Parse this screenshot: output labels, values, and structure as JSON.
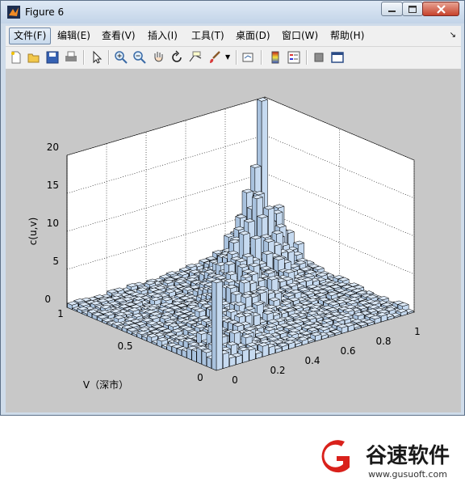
{
  "window": {
    "title": "Figure 6"
  },
  "menus": [
    {
      "id": "file",
      "label": "文件(F)"
    },
    {
      "id": "edit",
      "label": "编辑(E)"
    },
    {
      "id": "view",
      "label": "查看(V)"
    },
    {
      "id": "insert",
      "label": "插入(I)"
    },
    {
      "id": "tools",
      "label": "工具(T)"
    },
    {
      "id": "desktop",
      "label": "桌面(D)"
    },
    {
      "id": "window",
      "label": "窗口(W)"
    },
    {
      "id": "help",
      "label": "帮助(H)"
    }
  ],
  "toolbar": [
    "new-figure-icon",
    "open-icon",
    "save-icon",
    "print-icon",
    "pointer-icon",
    "zoom-in-icon",
    "zoom-out-icon",
    "pan-icon",
    "rotate-icon",
    "data-cursor-icon",
    "brush-icon",
    "link-icon",
    "colorbar-icon",
    "legend-icon",
    "hide-tools-icon",
    "show-tools-icon"
  ],
  "chart_data": {
    "type": "bar3",
    "zlabel": "c(u,v)",
    "ylabel": "V（深市）",
    "z_ticks": [
      "0",
      "5",
      "10",
      "15",
      "20"
    ],
    "x_ticks": [
      "0",
      "0.2",
      "0.4",
      "0.6",
      "0.8",
      "1"
    ],
    "y_ticks": [
      "0",
      "0.5",
      "1"
    ],
    "zlim": [
      0,
      20
    ],
    "grid": true,
    "bar_color": "#c6daf0",
    "bin_counts": {
      "u": 30,
      "v": 30
    },
    "notable_bars": [
      {
        "u": 0.0,
        "v": 0.0,
        "value": 11.5
      },
      {
        "u": 0.95,
        "v": 0.95,
        "value": 20.5
      },
      {
        "u": 0.9,
        "v": 0.95,
        "value": 12.0
      },
      {
        "u": 0.85,
        "v": 0.9,
        "value": 9.5
      }
    ]
  },
  "watermark": {
    "brand": "谷速软件",
    "url": "www.gusuoft.com"
  }
}
